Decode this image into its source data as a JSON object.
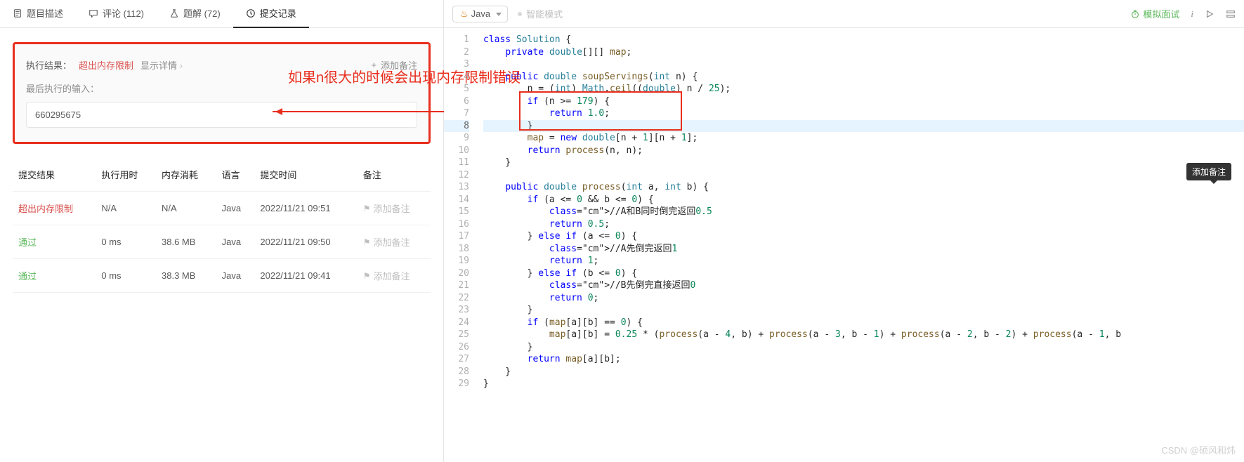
{
  "tabs": {
    "desc": "题目描述",
    "comments": "评论 (112)",
    "solutions": "题解 (72)",
    "submissions": "提交记录"
  },
  "result": {
    "label": "执行结果：",
    "status": "超出内存限制",
    "detail": "显示详情",
    "add_note": "添加备注",
    "last_input_label": "最后执行的输入：",
    "input_value": "660295675"
  },
  "annotation": "如果n很大的时候会出现内存限制错误",
  "table": {
    "headers": {
      "result": "提交结果",
      "time": "执行用时",
      "memory": "内存消耗",
      "lang": "语言",
      "submit_time": "提交时间",
      "note": "备注"
    },
    "rows": [
      {
        "result": "超出内存限制",
        "status": "error",
        "time": "N/A",
        "memory": "N/A",
        "lang": "Java",
        "submit_time": "2022/11/21 09:51",
        "note": "添加备注"
      },
      {
        "result": "通过",
        "status": "pass",
        "time": "0 ms",
        "memory": "38.6 MB",
        "lang": "Java",
        "submit_time": "2022/11/21 09:50",
        "note": "添加备注"
      },
      {
        "result": "通过",
        "status": "pass",
        "time": "0 ms",
        "memory": "38.3 MB",
        "lang": "Java",
        "submit_time": "2022/11/21 09:41",
        "note": "添加备注"
      }
    ]
  },
  "tooltip": "添加备注",
  "toolbar": {
    "lang": "Java",
    "smart": "智能模式",
    "mock": "模拟面试",
    "info": "i"
  },
  "code": {
    "lines": [
      "class Solution {",
      "    private double[][] map;",
      "",
      "    public double soupServings(int n) {",
      "        n = (int) Math.ceil((double) n / 25);",
      "        if (n >= 179) {",
      "            return 1.0;",
      "        }",
      "        map = new double[n + 1][n + 1];",
      "        return process(n, n);",
      "    }",
      "",
      "    public double process(int a, int b) {",
      "        if (a <= 0 && b <= 0) {",
      "            //A和B同时倒完返回0.5",
      "            return 0.5;",
      "        } else if (a <= 0) {",
      "            //A先倒完返回1",
      "            return 1;",
      "        } else if (b <= 0) {",
      "            //B先倒完直接返回0",
      "            return 0;",
      "        }",
      "        if (map[a][b] == 0) {",
      "            map[a][b] = 0.25 * (process(a - 4, b) + process(a - 3, b - 1) + process(a - 2, b - 2) + process(a - 1, b",
      "        }",
      "        return map[a][b];",
      "    }",
      "}"
    ],
    "highlight": 8
  },
  "watermark": "CSDN @硕风和炜"
}
